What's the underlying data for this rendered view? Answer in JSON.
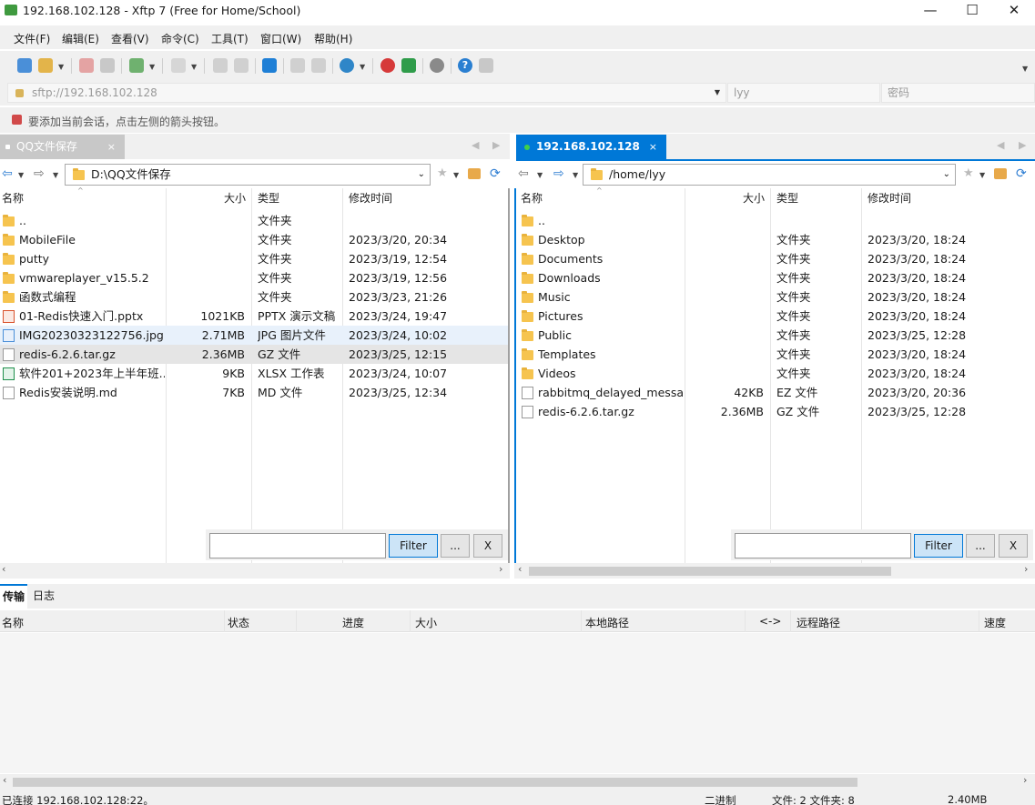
{
  "window": {
    "title": "192.168.102.128 - Xftp 7 (Free for Home/School)",
    "minimize": "—",
    "maximize": "☐",
    "close": "✕"
  },
  "menu": [
    "文件(F)",
    "编辑(E)",
    "查看(V)",
    "命令(C)",
    "工具(T)",
    "窗口(W)",
    "帮助(H)"
  ],
  "address": {
    "url": "sftp://192.168.102.128",
    "user": "lyy",
    "password_placeholder": "密码"
  },
  "hint": "要添加当前会话，点击左侧的箭头按钮。",
  "left": {
    "tab": "QQ文件保存",
    "path": "D:\\QQ文件保存",
    "headers": {
      "name": "名称",
      "size": "大小",
      "type": "类型",
      "modified": "修改时间"
    },
    "files": [
      {
        "name": "..",
        "size": "",
        "type": "文件夹",
        "modified": "",
        "icon": "folder"
      },
      {
        "name": "MobileFile",
        "size": "",
        "type": "文件夹",
        "modified": "2023/3/20, 20:34",
        "icon": "folder"
      },
      {
        "name": "putty",
        "size": "",
        "type": "文件夹",
        "modified": "2023/3/19, 12:54",
        "icon": "folder"
      },
      {
        "name": "vmwareplayer_v15.5.2",
        "size": "",
        "type": "文件夹",
        "modified": "2023/3/19, 12:56",
        "icon": "folder"
      },
      {
        "name": "函数式编程",
        "size": "",
        "type": "文件夹",
        "modified": "2023/3/23, 21:26",
        "icon": "folder"
      },
      {
        "name": "01-Redis快速入门.pptx",
        "size": "1021KB",
        "type": "PPTX 演示文稿",
        "modified": "2023/3/24, 19:47",
        "icon": "pptx"
      },
      {
        "name": "IMG20230323122756.jpg",
        "size": "2.71MB",
        "type": "JPG 图片文件",
        "modified": "2023/3/24, 10:02",
        "icon": "jpg"
      },
      {
        "name": "redis-6.2.6.tar.gz",
        "size": "2.36MB",
        "type": "GZ 文件",
        "modified": "2023/3/25, 12:15",
        "icon": "doc"
      },
      {
        "name": "软件201+2023年上半年班...",
        "size": "9KB",
        "type": "XLSX 工作表",
        "modified": "2023/3/24, 10:07",
        "icon": "xlsx"
      },
      {
        "name": "Redis安装说明.md",
        "size": "7KB",
        "type": "MD 文件",
        "modified": "2023/3/25, 12:34",
        "icon": "md"
      }
    ],
    "filter": {
      "button": "Filter",
      "more": "...",
      "clear": "X"
    }
  },
  "right": {
    "tab": "192.168.102.128",
    "path": "/home/lyy",
    "headers": {
      "name": "名称",
      "size": "大小",
      "type": "类型",
      "modified": "修改时间"
    },
    "files": [
      {
        "name": "..",
        "size": "",
        "type": "",
        "modified": "",
        "icon": "folder"
      },
      {
        "name": "Desktop",
        "size": "",
        "type": "文件夹",
        "modified": "2023/3/20, 18:24",
        "icon": "folder"
      },
      {
        "name": "Documents",
        "size": "",
        "type": "文件夹",
        "modified": "2023/3/20, 18:24",
        "icon": "folder"
      },
      {
        "name": "Downloads",
        "size": "",
        "type": "文件夹",
        "modified": "2023/3/20, 18:24",
        "icon": "folder"
      },
      {
        "name": "Music",
        "size": "",
        "type": "文件夹",
        "modified": "2023/3/20, 18:24",
        "icon": "folder"
      },
      {
        "name": "Pictures",
        "size": "",
        "type": "文件夹",
        "modified": "2023/3/20, 18:24",
        "icon": "folder"
      },
      {
        "name": "Public",
        "size": "",
        "type": "文件夹",
        "modified": "2023/3/25, 12:28",
        "icon": "folder"
      },
      {
        "name": "Templates",
        "size": "",
        "type": "文件夹",
        "modified": "2023/3/20, 18:24",
        "icon": "folder"
      },
      {
        "name": "Videos",
        "size": "",
        "type": "文件夹",
        "modified": "2023/3/20, 18:24",
        "icon": "folder"
      },
      {
        "name": "rabbitmq_delayed_messa...",
        "size": "42KB",
        "type": "EZ 文件",
        "modified": "2023/3/20, 20:36",
        "icon": "doc"
      },
      {
        "name": "redis-6.2.6.tar.gz",
        "size": "2.36MB",
        "type": "GZ 文件",
        "modified": "2023/3/25, 12:28",
        "icon": "doc"
      }
    ],
    "filter": {
      "button": "Filter",
      "more": "...",
      "clear": "X"
    }
  },
  "bottom": {
    "tabs": [
      "传输",
      "日志"
    ],
    "columns": [
      "名称",
      "状态",
      "进度",
      "大小",
      "本地路径",
      "<->",
      "远程路径",
      "速度"
    ]
  },
  "status": {
    "connection": "已连接 192.168.102.128:22。",
    "mode": "二进制",
    "counts": "文件: 2  文件夹: 8",
    "size": "2.40MB"
  },
  "colors": {
    "accent": "#0078d7",
    "folder": "#f6c44f",
    "selected_row": "#e5e5e5",
    "hover_row": "#e8f1fb"
  }
}
